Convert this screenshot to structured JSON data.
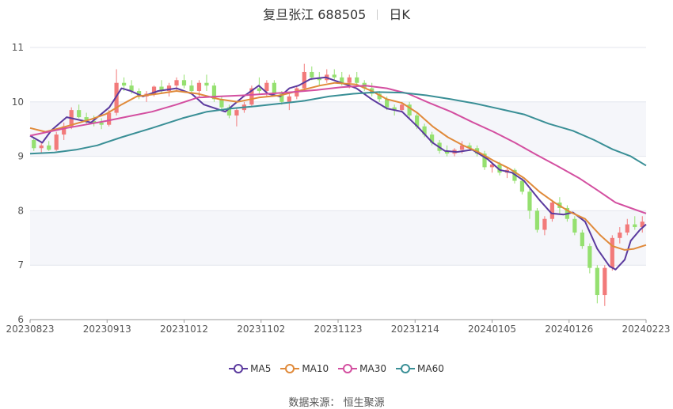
{
  "header": {
    "stock": "复旦张江 688505",
    "period": "日K"
  },
  "source": {
    "label": "数据来源：",
    "name": "恒生聚源"
  },
  "colors": {
    "up": "#f27a7a",
    "down": "#95e070",
    "ma5": "#5b3a9e",
    "ma10": "#e08a3a",
    "ma30": "#d34fa0",
    "ma60": "#3a8f96"
  },
  "chart_data": {
    "type": "candlestick",
    "y_ticks": [
      "6",
      "7",
      "8",
      "9",
      "10",
      "11"
    ],
    "ylim": [
      6,
      11
    ],
    "x_ticks": [
      "20230823",
      "20230913",
      "20231012",
      "20231102",
      "20231123",
      "20231214",
      "20240105",
      "20240126",
      "20240223"
    ],
    "grid": "horizontal",
    "legend": "bottom-center",
    "legend_items": [
      "MA5",
      "MA10",
      "MA30",
      "MA60"
    ],
    "ohlc": [
      [
        9.3,
        9.35,
        9.1,
        9.15
      ],
      [
        9.15,
        9.25,
        9.05,
        9.2
      ],
      [
        9.2,
        9.28,
        9.1,
        9.12
      ],
      [
        9.12,
        9.45,
        9.1,
        9.4
      ],
      [
        9.4,
        9.62,
        9.3,
        9.55
      ],
      [
        9.55,
        9.9,
        9.5,
        9.85
      ],
      [
        9.85,
        9.95,
        9.7,
        9.72
      ],
      [
        9.72,
        9.8,
        9.6,
        9.65
      ],
      [
        9.65,
        9.75,
        9.55,
        9.62
      ],
      [
        9.62,
        9.7,
        9.5,
        9.58
      ],
      [
        9.58,
        9.85,
        9.55,
        9.8
      ],
      [
        9.8,
        10.6,
        9.75,
        10.35
      ],
      [
        10.35,
        10.45,
        10.2,
        10.3
      ],
      [
        10.3,
        10.4,
        10.15,
        10.2
      ],
      [
        10.2,
        10.25,
        10.05,
        10.1
      ],
      [
        10.1,
        10.2,
        10.0,
        10.15
      ],
      [
        10.15,
        10.3,
        10.1,
        10.28
      ],
      [
        10.28,
        10.4,
        10.15,
        10.2
      ],
      [
        10.2,
        10.35,
        10.1,
        10.3
      ],
      [
        10.3,
        10.45,
        10.2,
        10.4
      ],
      [
        10.4,
        10.5,
        10.25,
        10.3
      ],
      [
        10.3,
        10.4,
        10.15,
        10.2
      ],
      [
        10.2,
        10.4,
        10.1,
        10.35
      ],
      [
        10.35,
        10.5,
        10.2,
        10.3
      ],
      [
        10.3,
        10.35,
        10.0,
        10.05
      ],
      [
        10.05,
        10.1,
        9.85,
        9.9
      ],
      [
        9.9,
        9.95,
        9.7,
        9.75
      ],
      [
        9.75,
        9.9,
        9.55,
        9.85
      ],
      [
        9.85,
        10.0,
        9.8,
        9.95
      ],
      [
        9.95,
        10.3,
        9.9,
        10.25
      ],
      [
        10.25,
        10.45,
        10.15,
        10.2
      ],
      [
        10.2,
        10.4,
        10.1,
        10.35
      ],
      [
        10.35,
        10.4,
        10.1,
        10.15
      ],
      [
        10.15,
        10.2,
        9.95,
        10.0
      ],
      [
        10.0,
        10.15,
        9.85,
        10.1
      ],
      [
        10.1,
        10.3,
        10.05,
        10.25
      ],
      [
        10.25,
        10.7,
        10.2,
        10.55
      ],
      [
        10.55,
        10.65,
        10.4,
        10.45
      ],
      [
        10.45,
        10.55,
        10.3,
        10.4
      ],
      [
        10.4,
        10.6,
        10.35,
        10.5
      ],
      [
        10.5,
        10.6,
        10.4,
        10.45
      ],
      [
        10.45,
        10.55,
        10.3,
        10.35
      ],
      [
        10.35,
        10.5,
        10.25,
        10.45
      ],
      [
        10.45,
        10.55,
        10.3,
        10.35
      ],
      [
        10.35,
        10.4,
        10.2,
        10.25
      ],
      [
        10.25,
        10.35,
        10.1,
        10.15
      ],
      [
        10.15,
        10.2,
        10.0,
        10.05
      ],
      [
        10.05,
        10.1,
        9.85,
        9.9
      ],
      [
        9.9,
        9.95,
        9.75,
        9.85
      ],
      [
        9.85,
        10.0,
        9.8,
        9.95
      ],
      [
        9.95,
        10.0,
        9.7,
        9.75
      ],
      [
        9.75,
        9.8,
        9.5,
        9.55
      ],
      [
        9.55,
        9.6,
        9.35,
        9.4
      ],
      [
        9.4,
        9.45,
        9.2,
        9.25
      ],
      [
        9.25,
        9.3,
        9.05,
        9.1
      ],
      [
        9.1,
        9.2,
        9.0,
        9.05
      ],
      [
        9.05,
        9.15,
        9.0,
        9.12
      ],
      [
        9.12,
        9.28,
        9.05,
        9.2
      ],
      [
        9.2,
        9.25,
        9.1,
        9.15
      ],
      [
        9.15,
        9.2,
        9.0,
        9.05
      ],
      [
        9.05,
        9.1,
        8.75,
        8.8
      ],
      [
        8.8,
        8.9,
        8.7,
        8.85
      ],
      [
        8.85,
        8.9,
        8.65,
        8.7
      ],
      [
        8.7,
        8.8,
        8.6,
        8.75
      ],
      [
        8.75,
        8.78,
        8.5,
        8.55
      ],
      [
        8.55,
        8.6,
        8.3,
        8.35
      ],
      [
        8.35,
        8.4,
        7.85,
        8.0
      ],
      [
        8.0,
        8.05,
        7.6,
        7.65
      ],
      [
        7.65,
        7.9,
        7.55,
        7.85
      ],
      [
        7.85,
        8.2,
        7.8,
        8.15
      ],
      [
        8.15,
        8.25,
        7.95,
        8.05
      ],
      [
        8.05,
        8.1,
        7.8,
        7.85
      ],
      [
        7.85,
        7.9,
        7.55,
        7.6
      ],
      [
        7.6,
        7.65,
        7.3,
        7.35
      ],
      [
        7.35,
        7.4,
        6.85,
        6.95
      ],
      [
        6.95,
        7.0,
        6.3,
        6.45
      ],
      [
        6.45,
        7.0,
        6.25,
        6.95
      ],
      [
        6.95,
        7.55,
        6.9,
        7.5
      ],
      [
        7.5,
        7.7,
        7.4,
        7.6
      ],
      [
        7.6,
        7.85,
        7.55,
        7.75
      ],
      [
        7.75,
        7.9,
        7.65,
        7.7
      ],
      [
        7.7,
        7.9,
        7.6,
        7.8
      ]
    ],
    "series": [
      {
        "name": "MA5",
        "values": [
          [
            0,
            9.38
          ],
          [
            4,
            9.25
          ],
          [
            7,
            9.48
          ],
          [
            12,
            9.72
          ],
          [
            20,
            9.62
          ],
          [
            26,
            9.9
          ],
          [
            30,
            10.25
          ],
          [
            33,
            10.2
          ],
          [
            37,
            10.1
          ],
          [
            42,
            10.2
          ],
          [
            48,
            10.25
          ],
          [
            53,
            10.15
          ],
          [
            57,
            9.95
          ],
          [
            64,
            9.82
          ],
          [
            70,
            10.1
          ],
          [
            75,
            10.3
          ],
          [
            78,
            10.15
          ],
          [
            82,
            10.1
          ],
          [
            85,
            10.25
          ],
          [
            88,
            10.3
          ],
          [
            92,
            10.42
          ],
          [
            97,
            10.45
          ],
          [
            102,
            10.35
          ],
          [
            107,
            10.25
          ],
          [
            112,
            10.05
          ],
          [
            117,
            9.88
          ],
          [
            122,
            9.82
          ],
          [
            127,
            9.55
          ],
          [
            132,
            9.25
          ],
          [
            136,
            9.1
          ],
          [
            140,
            9.08
          ],
          [
            145,
            9.12
          ],
          [
            150,
            8.95
          ],
          [
            154,
            8.75
          ],
          [
            158,
            8.7
          ],
          [
            162,
            8.55
          ],
          [
            167,
            8.2
          ],
          [
            171,
            7.95
          ],
          [
            175,
            7.93
          ],
          [
            178,
            7.97
          ],
          [
            182,
            7.8
          ],
          [
            186,
            7.3
          ],
          [
            190,
            6.98
          ],
          [
            192,
            6.92
          ],
          [
            195,
            7.1
          ],
          [
            197,
            7.45
          ],
          [
            200,
            7.65
          ],
          [
            202,
            7.75
          ]
        ]
      },
      {
        "name": "MA10",
        "values": [
          [
            0,
            9.52
          ],
          [
            5,
            9.45
          ],
          [
            10,
            9.52
          ],
          [
            15,
            9.6
          ],
          [
            20,
            9.68
          ],
          [
            25,
            9.78
          ],
          [
            30,
            9.95
          ],
          [
            35,
            10.1
          ],
          [
            42,
            10.15
          ],
          [
            48,
            10.2
          ],
          [
            55,
            10.15
          ],
          [
            62,
            10.05
          ],
          [
            68,
            10.0
          ],
          [
            75,
            10.08
          ],
          [
            82,
            10.12
          ],
          [
            88,
            10.2
          ],
          [
            95,
            10.3
          ],
          [
            100,
            10.35
          ],
          [
            107,
            10.32
          ],
          [
            112,
            10.2
          ],
          [
            117,
            10.05
          ],
          [
            122,
            9.98
          ],
          [
            127,
            9.8
          ],
          [
            132,
            9.55
          ],
          [
            137,
            9.35
          ],
          [
            142,
            9.2
          ],
          [
            147,
            9.08
          ],
          [
            152,
            8.92
          ],
          [
            157,
            8.78
          ],
          [
            162,
            8.6
          ],
          [
            167,
            8.35
          ],
          [
            172,
            8.15
          ],
          [
            177,
            7.98
          ],
          [
            182,
            7.85
          ],
          [
            187,
            7.55
          ],
          [
            191,
            7.35
          ],
          [
            195,
            7.28
          ],
          [
            198,
            7.3
          ],
          [
            202,
            7.37
          ]
        ]
      },
      {
        "name": "MA30",
        "values": [
          [
            0,
            9.38
          ],
          [
            6,
            9.45
          ],
          [
            12,
            9.52
          ],
          [
            18,
            9.58
          ],
          [
            25,
            9.65
          ],
          [
            32,
            9.73
          ],
          [
            40,
            9.82
          ],
          [
            48,
            9.95
          ],
          [
            55,
            10.08
          ],
          [
            62,
            10.1
          ],
          [
            70,
            10.12
          ],
          [
            78,
            10.15
          ],
          [
            86,
            10.18
          ],
          [
            94,
            10.22
          ],
          [
            102,
            10.27
          ],
          [
            110,
            10.3
          ],
          [
            117,
            10.25
          ],
          [
            124,
            10.15
          ],
          [
            131,
            9.98
          ],
          [
            138,
            9.82
          ],
          [
            145,
            9.63
          ],
          [
            152,
            9.45
          ],
          [
            159,
            9.25
          ],
          [
            166,
            9.03
          ],
          [
            173,
            8.82
          ],
          [
            180,
            8.6
          ],
          [
            186,
            8.38
          ],
          [
            192,
            8.15
          ],
          [
            197,
            8.05
          ],
          [
            202,
            7.95
          ]
        ]
      },
      {
        "name": "MA60",
        "values": [
          [
            0,
            9.05
          ],
          [
            8,
            9.07
          ],
          [
            15,
            9.12
          ],
          [
            22,
            9.2
          ],
          [
            30,
            9.35
          ],
          [
            40,
            9.52
          ],
          [
            50,
            9.7
          ],
          [
            58,
            9.82
          ],
          [
            66,
            9.88
          ],
          [
            74,
            9.92
          ],
          [
            82,
            9.97
          ],
          [
            90,
            10.02
          ],
          [
            98,
            10.1
          ],
          [
            106,
            10.15
          ],
          [
            114,
            10.18
          ],
          [
            122,
            10.17
          ],
          [
            130,
            10.12
          ],
          [
            138,
            10.05
          ],
          [
            146,
            9.97
          ],
          [
            154,
            9.87
          ],
          [
            162,
            9.77
          ],
          [
            170,
            9.6
          ],
          [
            178,
            9.47
          ],
          [
            185,
            9.3
          ],
          [
            191,
            9.13
          ],
          [
            197,
            9.0
          ],
          [
            202,
            8.83
          ]
        ]
      }
    ]
  }
}
